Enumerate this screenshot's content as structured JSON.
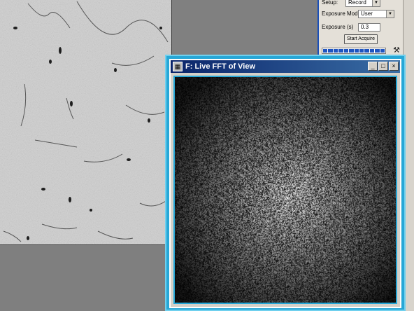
{
  "panel": {
    "setup_label": "Setup:",
    "setup_value": "Record",
    "exposure_mode_label": "Exposure Mode:",
    "exposure_mode_value": "User",
    "exposure_label": "Exposure (s)",
    "exposure_value": "0.3",
    "start_button": "Start Acquire",
    "progress_segments": 12,
    "tool_icon": "tool-icon"
  },
  "fft_window": {
    "title": "F: Live FFT of View",
    "minimize": "_",
    "maximize": "□",
    "close": "×"
  },
  "colors": {
    "window_border": "#27a7d6",
    "titlebar": "#0a246a",
    "progress": "#1f55c0",
    "background": "#7f7f7f"
  }
}
